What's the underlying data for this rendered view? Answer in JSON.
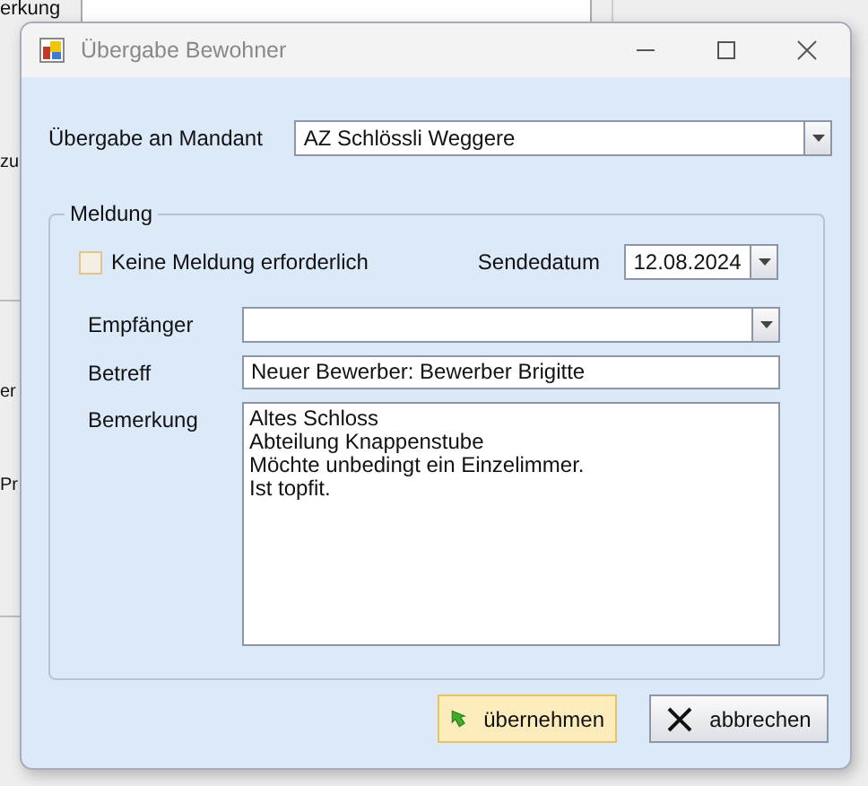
{
  "background": {
    "labels": [
      "erkung",
      "zu",
      "er",
      "Pr"
    ]
  },
  "window": {
    "title": "Übergabe Bewohner"
  },
  "mandant": {
    "label": "Übergabe an Mandant",
    "value": "AZ Schlössli Weggere"
  },
  "group": {
    "title": "Meldung",
    "no_message": {
      "label": "Keine Meldung erforderlich",
      "checked": false
    },
    "send_date": {
      "label": "Sendedatum",
      "value": "12.08.2024"
    },
    "recipient": {
      "label": "Empfänger"
    },
    "subject": {
      "label": "Betreff",
      "value": "Neuer Bewerber: Bewerber Brigitte"
    },
    "remark": {
      "label": "Bemerkung",
      "lines": [
        "Altes Schloss",
        "Abteilung Knappenstube",
        "Möchte unbedingt ein Einzelimmer.",
        "Ist topfit."
      ]
    }
  },
  "buttons": [
    {
      "label": "übernehmen",
      "kind": "ok"
    },
    {
      "label": "abbrechen",
      "kind": "cancel"
    }
  ]
}
